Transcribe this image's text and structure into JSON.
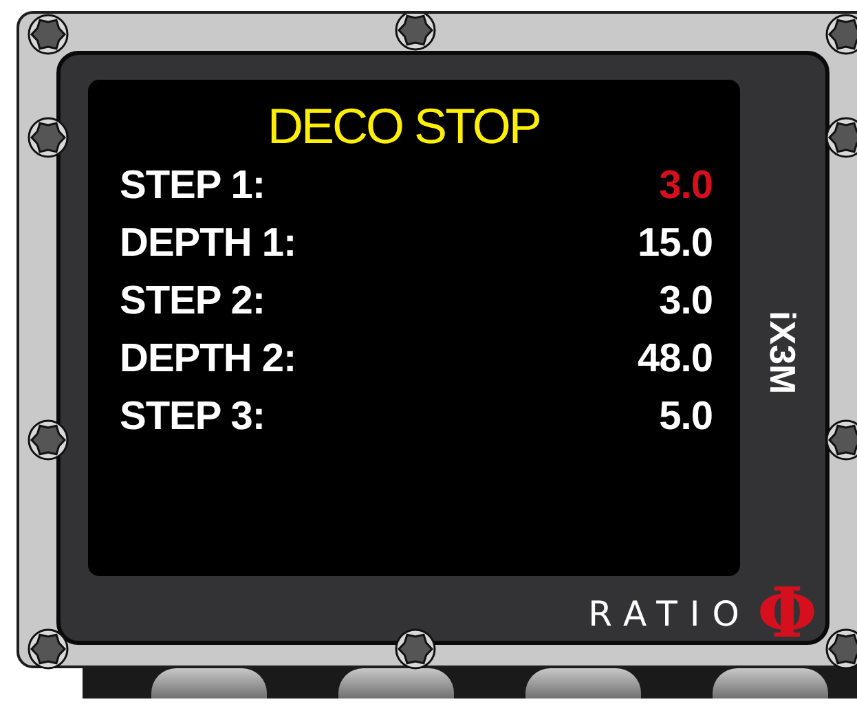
{
  "title": "DECO STOP",
  "rows": [
    {
      "label": "STEP 1:",
      "value": "3.0",
      "selected": true
    },
    {
      "label": "DEPTH 1:",
      "value": "15.0",
      "selected": false
    },
    {
      "label": "STEP 2:",
      "value": "3.0",
      "selected": false
    },
    {
      "label": "DEPTH 2:",
      "value": "48.0",
      "selected": false
    },
    {
      "label": "STEP 3:",
      "value": "5.0",
      "selected": false
    }
  ],
  "model": "iX3M",
  "brand": {
    "name": "RATIO",
    "logo": "Φ"
  }
}
